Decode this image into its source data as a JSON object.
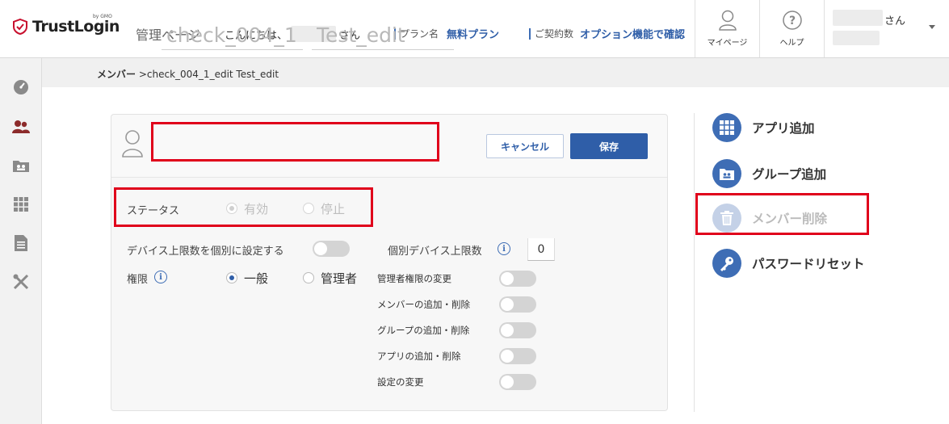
{
  "header": {
    "logo_text": "TrustLogin",
    "logo_sub": "by GMO",
    "admin_page": "管理ページ",
    "greeting_prefix": "こんにちは、",
    "greeting_suffix": "さん",
    "plan_label": "プラン名",
    "plan_value": "無料プラン",
    "contract_label": "ご契約数",
    "contract_value": "オプション機能で確認",
    "mypage": "マイページ",
    "help": "ヘルプ",
    "user_suffix": "さん"
  },
  "sidebar": {
    "items": [
      "dashboard-icon",
      "members-icon",
      "groups-icon",
      "apps-icon",
      "documents-icon",
      "settings-icon"
    ]
  },
  "breadcrumb": {
    "root": "メンバー",
    "separator": " >",
    "current": "check_004_1_edit Test_edit"
  },
  "form": {
    "last_name_value": "check_004_1",
    "first_name_value": "Test_edit",
    "cancel_label": "キャンセル",
    "save_label": "保存",
    "status_label": "ステータス",
    "status_options": [
      "有効",
      "停止"
    ],
    "status_selected": "有効",
    "device_limit_label": "デバイス上限数を個別に設定する",
    "device_limit_enabled": false,
    "individual_limit_label": "個別デバイス上限数",
    "individual_limit_value": "0",
    "role_label": "権限",
    "role_options": [
      "一般",
      "管理者"
    ],
    "role_selected": "一般",
    "permissions": [
      {
        "label": "管理者権限の変更",
        "enabled": false
      },
      {
        "label": "メンバーの追加・削除",
        "enabled": false
      },
      {
        "label": "グループの追加・削除",
        "enabled": false
      },
      {
        "label": "アプリの追加・削除",
        "enabled": false
      },
      {
        "label": "設定の変更",
        "enabled": false
      }
    ]
  },
  "actions": {
    "add_app": "アプリ追加",
    "add_group": "グループ追加",
    "delete_member": "メンバー削除",
    "password_reset": "パスワードリセット"
  },
  "colors": {
    "brand_red": "#c8102e",
    "accent_blue": "#2f5ea8",
    "highlight_red": "#e0001b"
  }
}
